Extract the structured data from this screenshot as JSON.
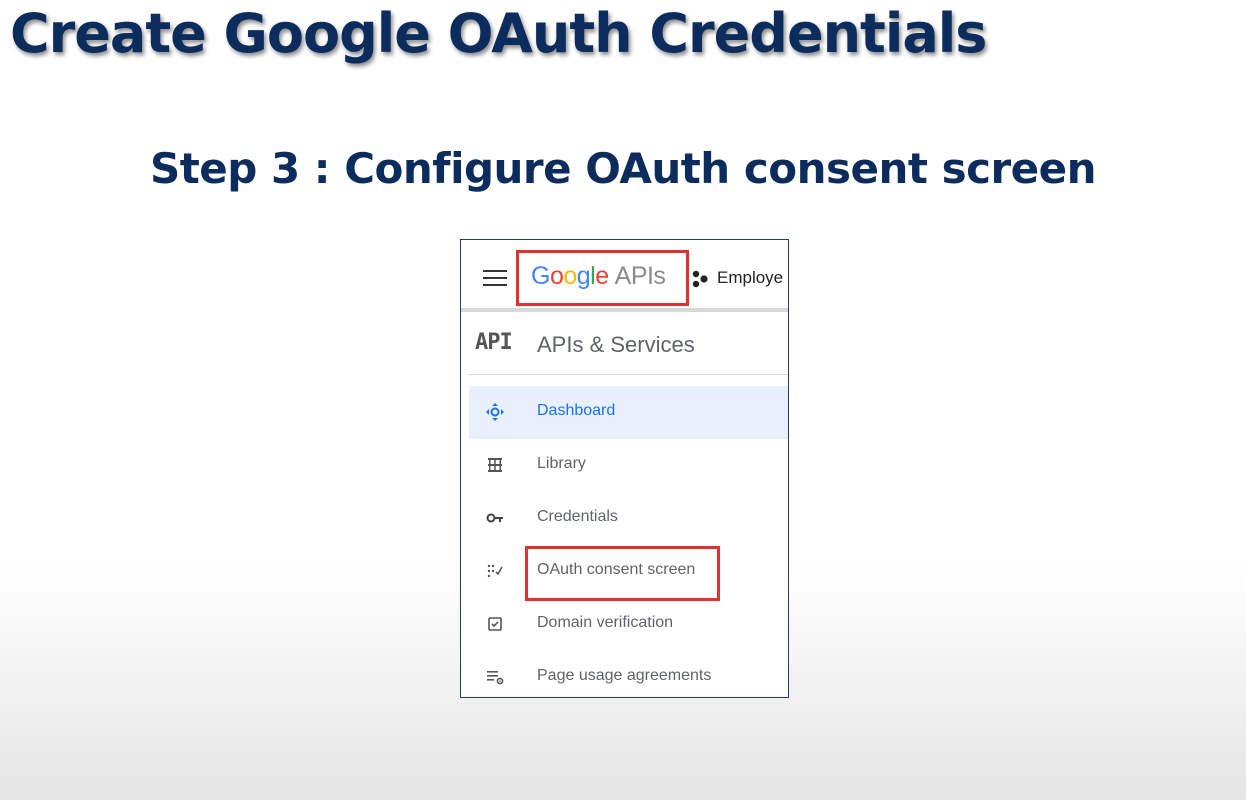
{
  "slide": {
    "title": "Create Google OAuth Credentials",
    "subtitle": "Step 3 : Configure OAuth consent screen"
  },
  "topbar": {
    "menu_icon": "hamburger-menu-icon",
    "logo_letters": [
      "G",
      "o",
      "o",
      "g",
      "l",
      "e"
    ],
    "logo_suffix": "APIs",
    "project_icon": "project-dots-icon",
    "project_name": "Employe"
  },
  "section": {
    "icon_text": "API",
    "title": "APIs & Services"
  },
  "nav": {
    "items": [
      {
        "label": "Dashboard",
        "icon": "dashboard-icon",
        "active": true
      },
      {
        "label": "Library",
        "icon": "library-icon",
        "active": false
      },
      {
        "label": "Credentials",
        "icon": "key-icon",
        "active": false
      },
      {
        "label": "OAuth consent screen",
        "icon": "consent-screen-icon",
        "active": false
      },
      {
        "label": "Domain verification",
        "icon": "checkbox-icon",
        "active": false
      },
      {
        "label": "Page usage agreements",
        "icon": "settings-list-icon",
        "active": false
      }
    ]
  },
  "colors": {
    "title_navy": "#0b2c5c",
    "highlight_red": "#e03030",
    "active_blue": "#1a73e8",
    "active_bg": "#e8f0fe",
    "google_blue": "#4285f4",
    "google_red": "#ea4335",
    "google_yellow": "#fbbc05",
    "google_green": "#34a853"
  }
}
